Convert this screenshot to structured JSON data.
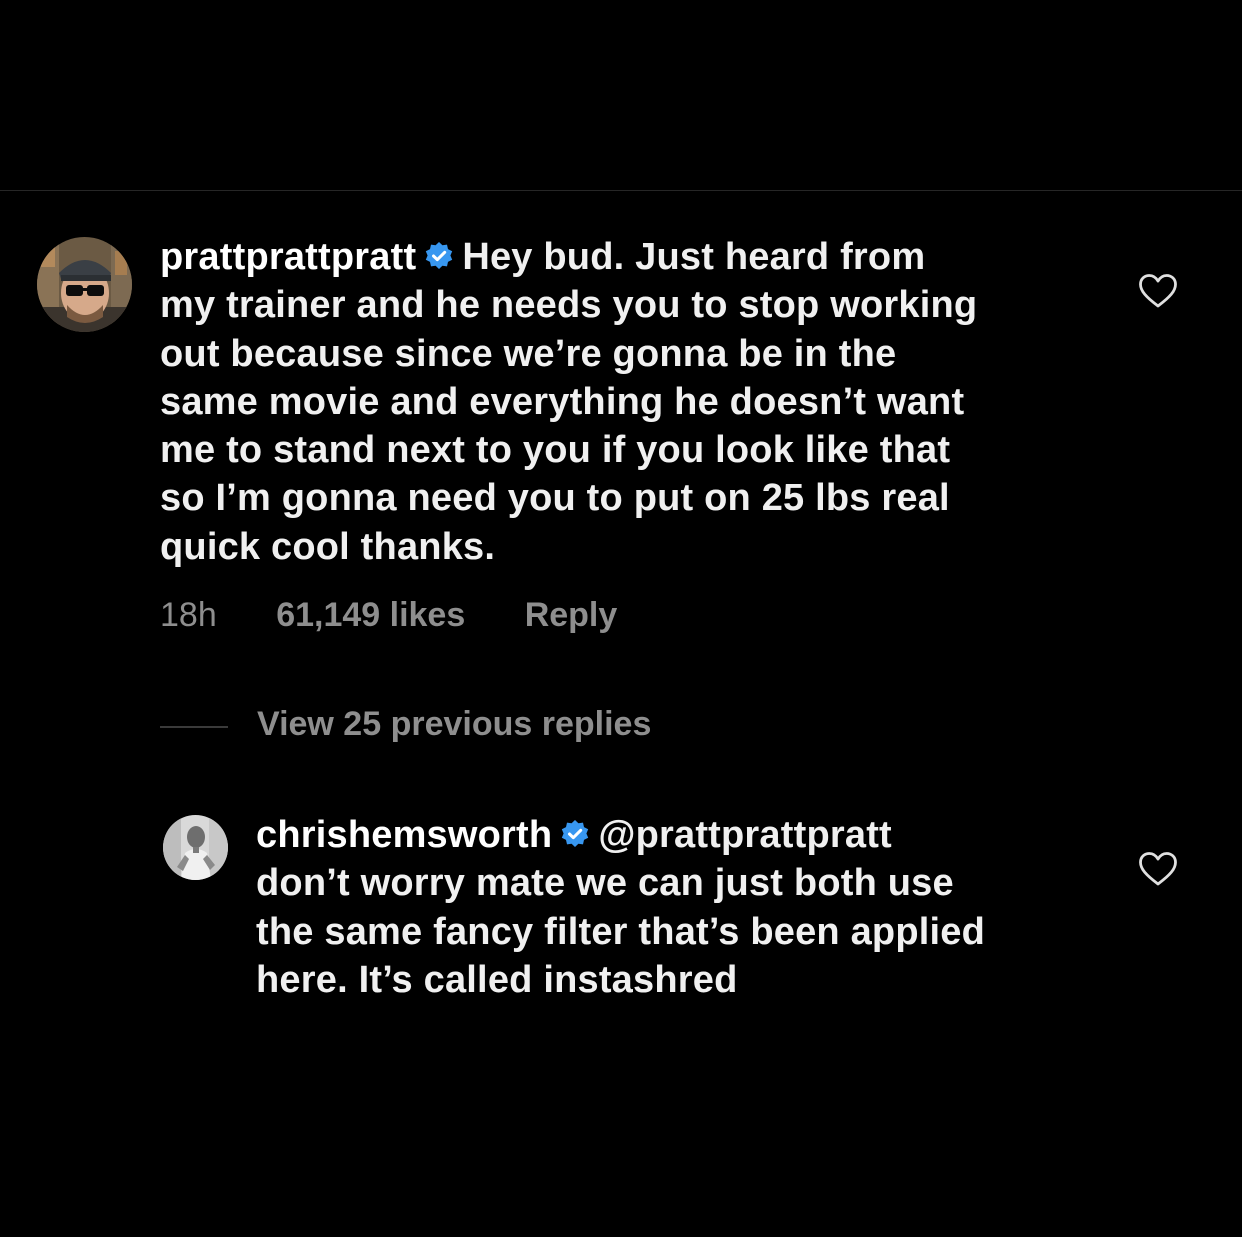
{
  "comments": [
    {
      "username": "prattprattpratt",
      "verified": true,
      "lines": [
        "Hey bud. Just heard from",
        "my trainer and he needs you to stop working",
        "out because since we’re gonna be in the",
        "same movie and everything he doesn’t want",
        "me to stand next to you if you look like that",
        "so I’m gonna need you to put on 25 lbs real",
        "quick cool thanks."
      ],
      "time": "18h",
      "likes": "61,149 likes",
      "reply_label": "Reply",
      "like_icon": "heart-outline-icon"
    },
    {
      "username": "chrishemsworth",
      "verified": true,
      "lines": [
        "@prattprattpratt",
        "don’t worry mate we can just both use",
        "the same fancy filter that’s been applied",
        "here. It’s called instashred"
      ],
      "like_icon": "heart-outline-icon"
    }
  ],
  "view_replies_label": "View 25 previous replies",
  "colors": {
    "background": "#000000",
    "text": "#f5f5f5",
    "muted": "#8e8e8e",
    "verified": "#3897f0"
  }
}
